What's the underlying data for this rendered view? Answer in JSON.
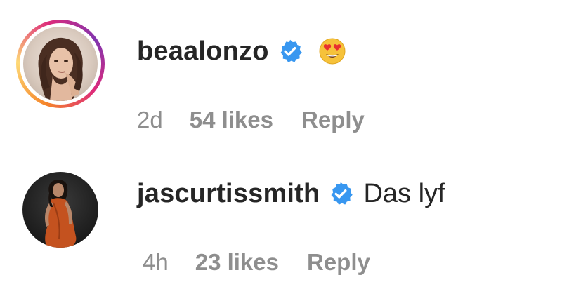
{
  "comments": [
    {
      "username": "beaalonzo",
      "verified": true,
      "text": "",
      "emoji": "heart-eyes-emoji",
      "time": "2d",
      "likes": "54 likes",
      "reply_label": "Reply",
      "has_story_ring": true
    },
    {
      "username": "jascurtissmith",
      "verified": true,
      "text": "Das lyf",
      "emoji": "",
      "time": "4h",
      "likes": "23 likes",
      "reply_label": "Reply",
      "has_story_ring": false
    }
  ],
  "colors": {
    "verified_blue": "#3897f0",
    "text": "#262626",
    "meta": "#8e8e8e"
  }
}
